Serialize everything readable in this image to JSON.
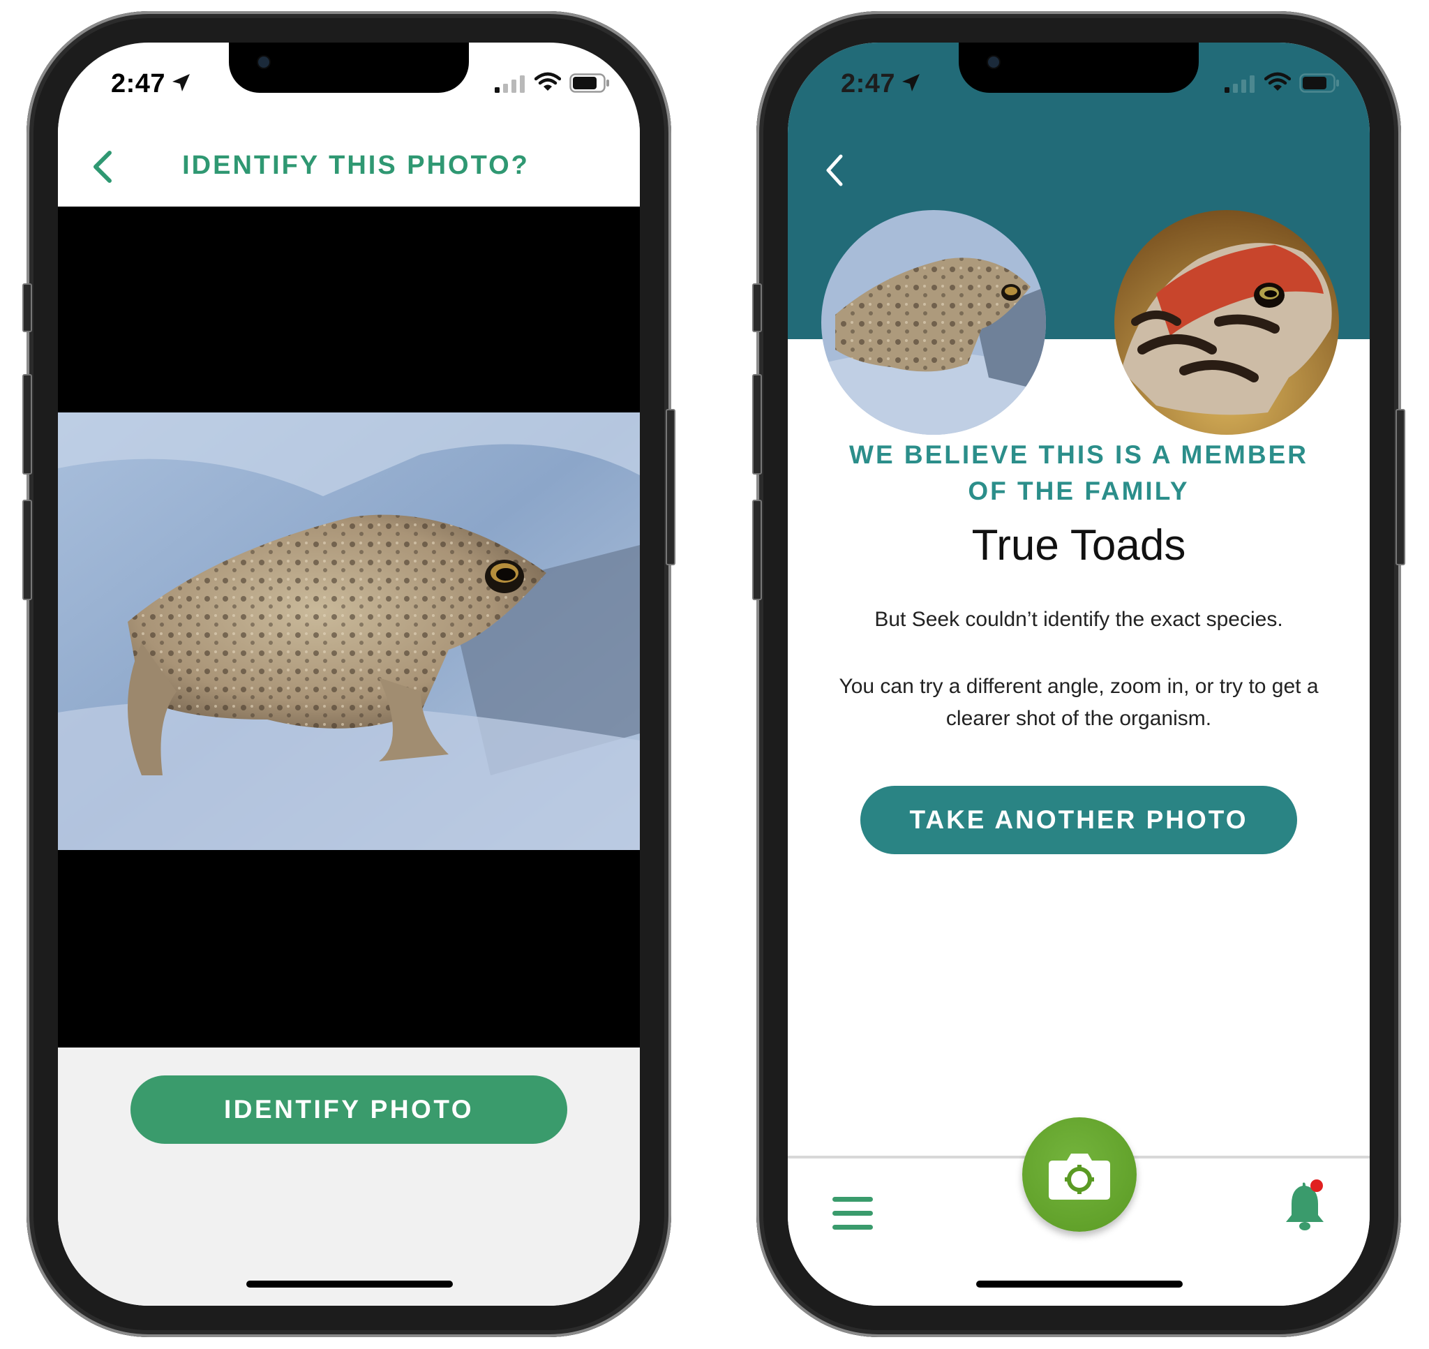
{
  "left_screen": {
    "status": {
      "time": "2:47"
    },
    "header": {
      "title": "IDENTIFY THIS PHOTO?"
    },
    "photo": {
      "subject": "toad-on-rock"
    },
    "identify_button": "IDENTIFY PHOTO"
  },
  "right_screen": {
    "status": {
      "time": "2:47"
    },
    "heading": "WE BELIEVE THIS IS A MEMBER OF THE FAMILY",
    "family_name": "True Toads",
    "message_1": "But Seek couldn’t identify the exact species.",
    "message_2": "You can try a different angle, zoom in, or try to get a clearer shot of the organism.",
    "take_another_button": "TAKE ANOTHER PHOTO",
    "tabbar": {
      "menu_icon": "hamburger-menu-icon",
      "camera_icon": "camera-icon",
      "notifications_icon": "bell-icon"
    }
  },
  "colors": {
    "green_title": "#2f9872",
    "green_button": "#3a9b6c",
    "teal_header": "#226b78",
    "teal_text": "#2b8e8a",
    "teal_button": "#2a8484",
    "camera_button": "#5a9a23",
    "notification_dot": "#e02020"
  }
}
